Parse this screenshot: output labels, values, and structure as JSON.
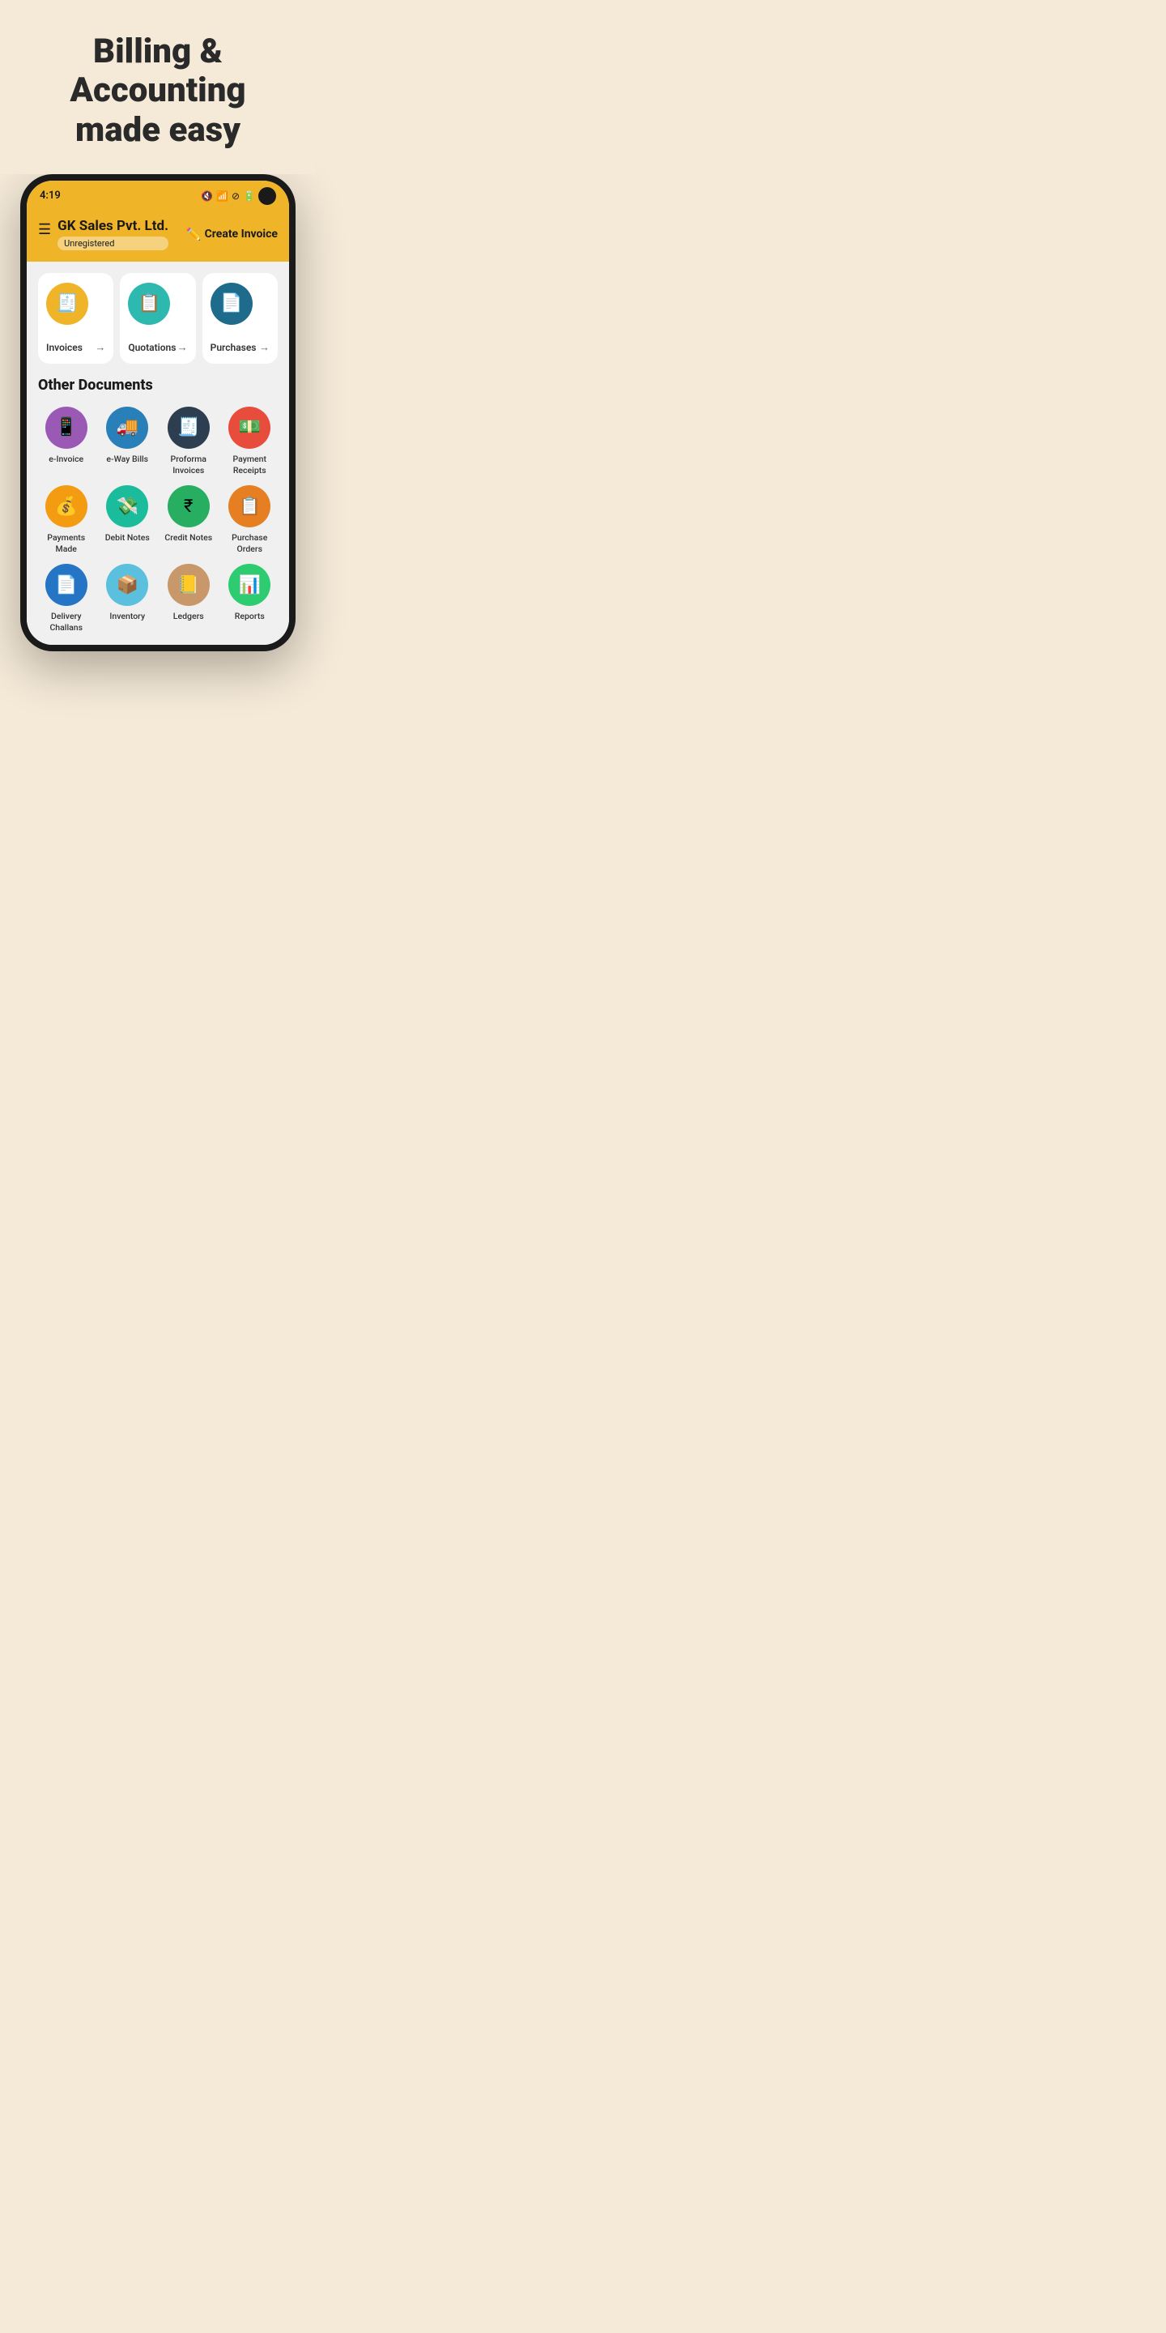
{
  "hero": {
    "title": "Billing & Accounting made easy"
  },
  "statusBar": {
    "time": "4:19"
  },
  "header": {
    "companyName": "GK Sales Pvt. Ltd.",
    "badge": "Unregistered",
    "createInvoiceLabel": "Create Invoice"
  },
  "topCards": [
    {
      "id": "invoices",
      "label": "Invoices",
      "iconSymbol": "🧾",
      "colorClass": "gold-circle"
    },
    {
      "id": "quotations",
      "label": "Quotations",
      "iconSymbol": "📋",
      "colorClass": "teal-circle"
    },
    {
      "id": "purchases",
      "label": "Purchases",
      "iconSymbol": "📄",
      "colorClass": "dark-teal-circle"
    }
  ],
  "otherDocs": {
    "sectionTitle": "Other Documents",
    "items": [
      {
        "id": "e-invoice",
        "label": "e-Invoice",
        "iconSymbol": "📱",
        "colorClass": "purple-circle"
      },
      {
        "id": "e-way-bills",
        "label": "e-Way Bills",
        "iconSymbol": "🚚",
        "colorClass": "blue-circle"
      },
      {
        "id": "proforma-invoices",
        "label": "Proforma Invoices",
        "iconSymbol": "🧾",
        "colorClass": "dark-circle"
      },
      {
        "id": "payment-receipts",
        "label": "Payment Receipts",
        "iconSymbol": "💵",
        "colorClass": "red-circle"
      },
      {
        "id": "payments-made",
        "label": "Payments Made",
        "iconSymbol": "💰",
        "colorClass": "gold2-circle"
      },
      {
        "id": "debit-notes",
        "label": "Debit Notes",
        "iconSymbol": "💸",
        "colorClass": "green-teal-circle"
      },
      {
        "id": "credit-notes",
        "label": "Credit Notes",
        "iconSymbol": "₹",
        "colorClass": "green-circle"
      },
      {
        "id": "purchase-orders",
        "label": "Purchase Orders",
        "iconSymbol": "📋",
        "colorClass": "orange-circle"
      },
      {
        "id": "delivery-challans",
        "label": "Delivery Challans",
        "iconSymbol": "📄",
        "colorClass": "blue2-circle"
      },
      {
        "id": "inventory",
        "label": "Inventory",
        "iconSymbol": "📦",
        "colorClass": "light-blue-circle"
      },
      {
        "id": "ledgers",
        "label": "Ledgers",
        "iconSymbol": "📒",
        "colorClass": "tan-circle"
      },
      {
        "id": "reports",
        "label": "Reports",
        "iconSymbol": "📊",
        "colorClass": "green2-circle"
      }
    ]
  }
}
